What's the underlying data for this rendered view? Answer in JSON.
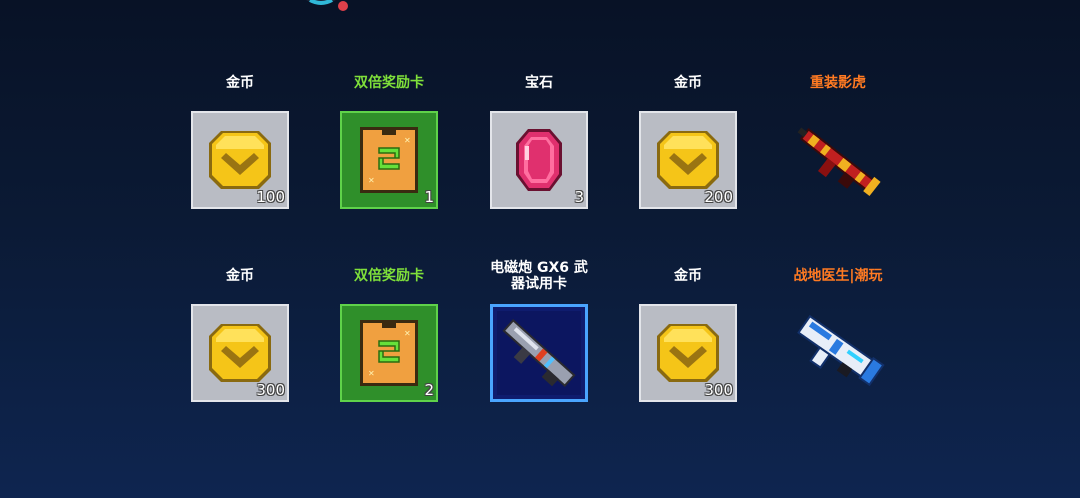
{
  "rewards": [
    {
      "label": "金币",
      "qty": "100",
      "icon": "gold-coin-icon",
      "tone": "white",
      "frame": "gray"
    },
    {
      "label": "双倍奖励卡",
      "qty": "1",
      "icon": "double-reward-card-icon",
      "tone": "green",
      "frame": "green"
    },
    {
      "label": "宝石",
      "qty": "3",
      "icon": "gem-icon",
      "tone": "white",
      "frame": "gray"
    },
    {
      "label": "金币",
      "qty": "200",
      "icon": "gold-coin-icon",
      "tone": "white",
      "frame": "gray"
    },
    {
      "label": "重装影虎",
      "qty": "",
      "icon": "red-gold-rifle-icon",
      "tone": "orange",
      "frame": "none"
    },
    {
      "label": "金币",
      "qty": "300",
      "icon": "gold-coin-icon",
      "tone": "white",
      "frame": "gray"
    },
    {
      "label": "双倍奖励卡",
      "qty": "2",
      "icon": "double-reward-card-icon",
      "tone": "green",
      "frame": "green"
    },
    {
      "label": "电磁炮 GX6 武器试用卡",
      "label_line1": "电磁炮 GX6 武",
      "label_line2": "器试用卡",
      "qty": "",
      "icon": "railgun-trial-card-icon",
      "tone": "white",
      "frame": "blue"
    },
    {
      "label": "金币",
      "qty": "300",
      "icon": "gold-coin-icon",
      "tone": "white",
      "frame": "gray"
    },
    {
      "label": "战地医生|潮玩",
      "qty": "",
      "icon": "blue-white-blaster-icon",
      "tone": "orange",
      "frame": "none"
    }
  ],
  "colors": {
    "green_label": "#7fe03a",
    "orange_label": "#ff7a22",
    "gold": "#f5c518",
    "gem": "#e0306e"
  }
}
